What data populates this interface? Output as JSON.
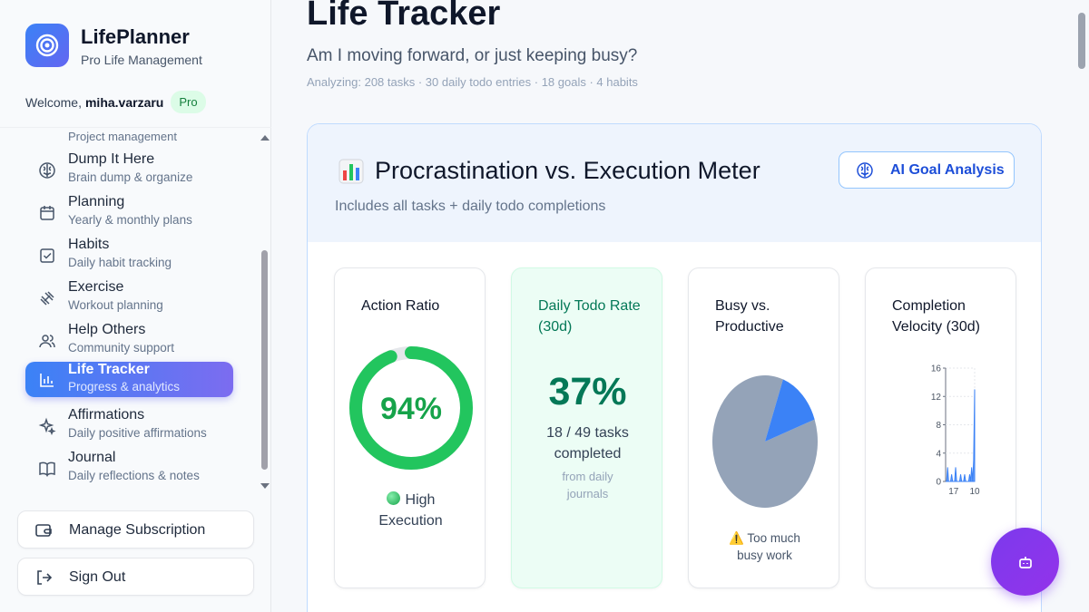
{
  "app": {
    "name": "LifePlanner",
    "tagline": "Pro Life Management",
    "welcome_prefix": "Welcome,",
    "username": "miha.varzaru",
    "plan_badge": "Pro"
  },
  "sidebar": {
    "cut_item_sub": "Project management",
    "items": [
      {
        "label": "Dump It Here",
        "sub": "Brain dump & organize",
        "icon": "brain-icon"
      },
      {
        "label": "Planning",
        "sub": "Yearly & monthly plans",
        "icon": "calendar-icon"
      },
      {
        "label": "Habits",
        "sub": "Daily habit tracking",
        "icon": "checkbox-icon"
      },
      {
        "label": "Exercise",
        "sub": "Workout planning",
        "icon": "dumbbell-icon"
      },
      {
        "label": "Help Others",
        "sub": "Community support",
        "icon": "users-icon"
      },
      {
        "label": "Life Tracker",
        "sub": "Progress & analytics",
        "icon": "bar-chart-icon",
        "active": true
      },
      {
        "label": "Affirmations",
        "sub": "Daily positive affirmations",
        "icon": "sparkles-icon"
      },
      {
        "label": "Journal",
        "sub": "Daily reflections & notes",
        "icon": "book-icon"
      }
    ],
    "manage_subscription": "Manage Subscription",
    "sign_out": "Sign Out"
  },
  "main": {
    "title": "Life Tracker",
    "question": "Am I moving forward, or just keeping busy?",
    "meta": "Analyzing: 208 tasks · 30 daily todo entries · 18 goals · 4 habits"
  },
  "meter": {
    "title": "Procrastination vs. Execution Meter",
    "subtitle": "Includes all tasks + daily todo completions",
    "ai_button": "AI Goal Analysis",
    "action_ratio": {
      "title": "Action Ratio",
      "value_label": "94%",
      "value": 94,
      "status_line1": "High",
      "status_line2": "Execution",
      "ring_color": "#22c55e"
    },
    "daily_todo": {
      "title": "Daily Todo Rate (30d)",
      "value_label": "37%",
      "detail_line1": "18 / 49 tasks",
      "detail_line2": "completed",
      "note_line1": "from daily",
      "note_line2": "journals"
    },
    "busy_productive": {
      "title": "Busy vs. Productive",
      "warning_line1": "Too much",
      "warning_line2": "busy work",
      "productive_fraction": 0.14,
      "busy_color": "#94a3b8",
      "productive_color": "#3b82f6"
    },
    "velocity": {
      "title": "Completion Velocity (30d)"
    }
  },
  "chart_data": {
    "type": "area",
    "title": "Completion Velocity (30d)",
    "y_ticks": [
      "16",
      "12",
      "8",
      "4",
      "0"
    ],
    "x_ticks": [
      "17",
      "10"
    ],
    "ylim": [
      0,
      16
    ],
    "x": [
      1,
      2,
      3,
      4,
      5,
      6,
      7,
      8,
      9,
      10,
      11,
      12,
      13,
      14,
      15,
      16,
      17,
      18,
      19,
      20,
      21,
      22,
      23,
      24,
      25,
      26,
      27,
      28,
      29,
      30
    ],
    "values": [
      0,
      0,
      2,
      0,
      0,
      0,
      1,
      0,
      0,
      0,
      2,
      0,
      0,
      0,
      0,
      1,
      0,
      0,
      0,
      1,
      0,
      0,
      0,
      0,
      1,
      0,
      2,
      0,
      3,
      13
    ],
    "color": "#3b82f6"
  }
}
